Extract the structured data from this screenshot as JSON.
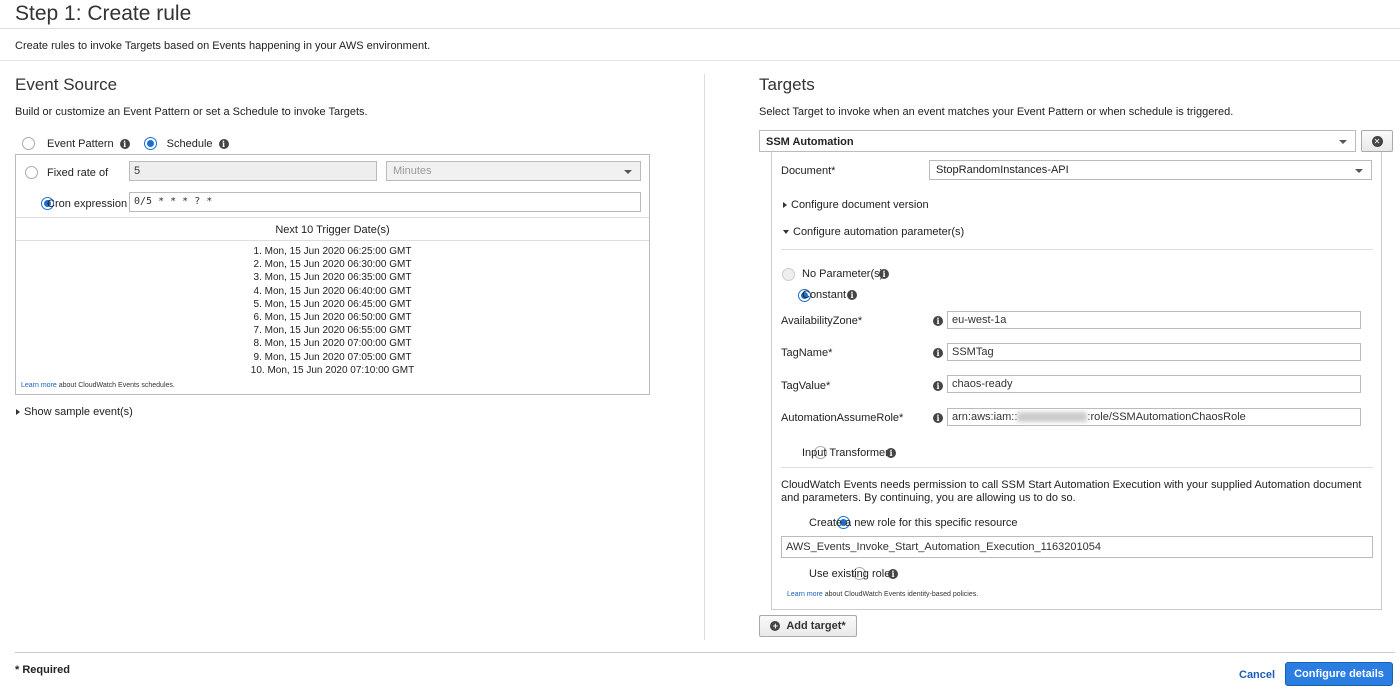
{
  "page": {
    "title": "Step 1: Create rule",
    "subtitle": "Create rules to invoke Targets based on Events happening in your AWS environment."
  },
  "event_source": {
    "heading": "Event Source",
    "description": "Build or customize an Event Pattern or set a Schedule to invoke Targets.",
    "event_pattern_label": "Event Pattern",
    "schedule_label": "Schedule",
    "fixed_rate_label": "Fixed rate of",
    "fixed_rate_value": "5",
    "fixed_rate_unit": "Minutes",
    "cron_label": "Cron expression",
    "cron_value": "0/5 * * * ? *",
    "next_dates_header": "Next 10 Trigger Date(s)",
    "next_dates": [
      "1. Mon, 15 Jun 2020 06:25:00 GMT",
      "2. Mon, 15 Jun 2020 06:30:00 GMT",
      "3. Mon, 15 Jun 2020 06:35:00 GMT",
      "4. Mon, 15 Jun 2020 06:40:00 GMT",
      "5. Mon, 15 Jun 2020 06:45:00 GMT",
      "6. Mon, 15 Jun 2020 06:50:00 GMT",
      "7. Mon, 15 Jun 2020 06:55:00 GMT",
      "8. Mon, 15 Jun 2020 07:00:00 GMT",
      "9. Mon, 15 Jun 2020 07:05:00 GMT",
      "10. Mon, 15 Jun 2020 07:10:00 GMT"
    ],
    "learn_more_link": "Learn more",
    "learn_more_text": "about CloudWatch Events schedules.",
    "show_sample": "Show sample event(s)"
  },
  "targets": {
    "heading": "Targets",
    "description": "Select Target to invoke when an event matches your Event Pattern or when schedule is triggered.",
    "target_type": "SSM Automation",
    "remove_icon": "close-icon",
    "document_label": "Document*",
    "document_value": "StopRandomInstances-API",
    "configure_version": "Configure document version",
    "configure_params": "Configure automation parameter(s)",
    "no_params_label": "No Parameter(s)",
    "constant_label": "Constant",
    "params": [
      {
        "label": "AvailabilityZone*",
        "value": "eu-west-1a"
      },
      {
        "label": "TagName*",
        "value": "SSMTag"
      },
      {
        "label": "TagValue*",
        "value": "chaos-ready"
      }
    ],
    "role_param_label": "AutomationAssumeRole*",
    "role_param_prefix": "arn:aws:iam::",
    "role_param_suffix": ":role/SSMAutomationChaosRole",
    "input_transformer_label": "Input Transformer",
    "permission_text": "CloudWatch Events needs permission to call SSM Start Automation Execution with your supplied Automation document and parameters. By continuing, you are allowing us to do so.",
    "create_role_label": "Create a new role for this specific resource",
    "role_name_value": "AWS_Events_Invoke_Start_Automation_Execution_1163201054",
    "use_existing_label": "Use existing role",
    "learn_more_link": "Learn more",
    "learn_more_text": "about CloudWatch Events identity-based policies.",
    "add_target": "Add target*"
  },
  "footer": {
    "required_note": "* Required",
    "cancel": "Cancel",
    "configure_details": "Configure details"
  },
  "colors": {
    "accent": "#1a6fd1",
    "link": "#1a5fb4",
    "primary_button": "#2a7de1"
  }
}
